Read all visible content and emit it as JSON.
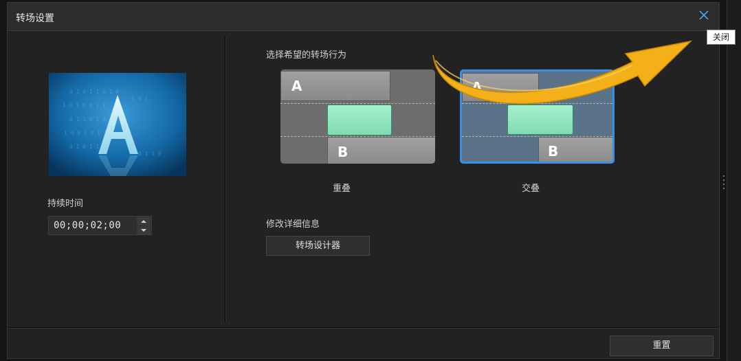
{
  "dialog": {
    "title": "转场设置",
    "close_tooltip": "关闭"
  },
  "left": {
    "duration_label": "持续时间",
    "duration_value": "00;00;02;00"
  },
  "right": {
    "choose_label": "选择希望的转场行为",
    "options": [
      {
        "label": "重叠",
        "selected": false,
        "letter_a": "A",
        "letter_b": "B"
      },
      {
        "label": "交叠",
        "selected": true,
        "letter_a": "A",
        "letter_b": "B"
      }
    ],
    "details_label": "修改详细信息",
    "designer_button": "转场设计器"
  },
  "footer": {
    "reset_button": "重置"
  },
  "colors": {
    "accent_selected": "#3d8fe0",
    "arrow": "#f4b018",
    "green_clip": "#8fe6c0"
  },
  "icons": [
    "close-icon",
    "spin-up-icon",
    "spin-down-icon",
    "annotation-arrow"
  ]
}
